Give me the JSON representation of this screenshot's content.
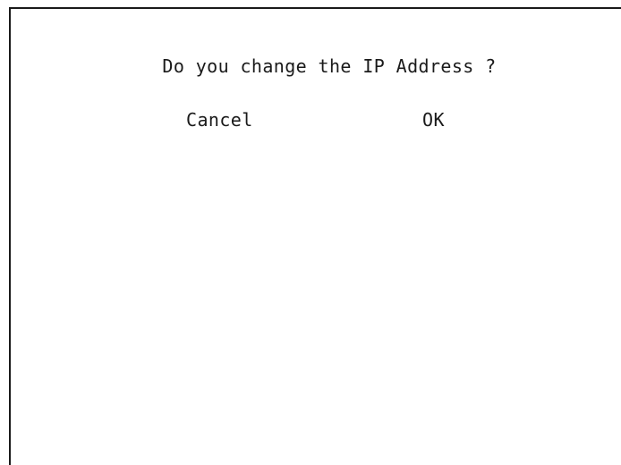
{
  "dialog": {
    "message": "Do you change the IP Address ?",
    "cancel_label": "Cancel",
    "ok_label": "OK"
  }
}
